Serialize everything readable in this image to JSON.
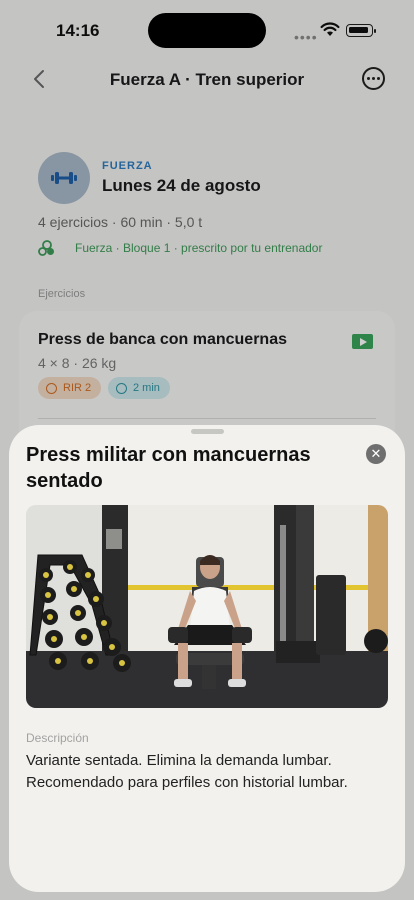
{
  "status_bar": {
    "time": "14:16"
  },
  "nav": {
    "title": "Fuerza A · Tren superior",
    "back_icon": "chevron-left-icon",
    "more_icon": "ellipsis-circle-icon"
  },
  "workout": {
    "category": "FUERZA",
    "date": "Lunes 24 de agosto",
    "stats": "4 ejercicios · 60 min · 5,0 t",
    "block": "Fuerza · Bloque 1 · prescrito por tu entrenador"
  },
  "exercises_section": {
    "label": "Ejercicios",
    "items": [
      {
        "name": "Press de banca con mancuernas",
        "sets": "4 × 8 · 26 kg",
        "rir": "RIR 2",
        "rest": "2 min"
      }
    ]
  },
  "sheet": {
    "title": "Press militar con mancuernas sentado",
    "description_label": "Descripción",
    "description": "Variante sentada. Elimina la demanda lumbar. Recomendado para perfiles con historial lumbar."
  },
  "colors": {
    "accent_blue": "#2f7cc0",
    "green": "#3f9b5a",
    "rir_orange": "#d26e23",
    "rest_teal": "#2f93a2"
  }
}
